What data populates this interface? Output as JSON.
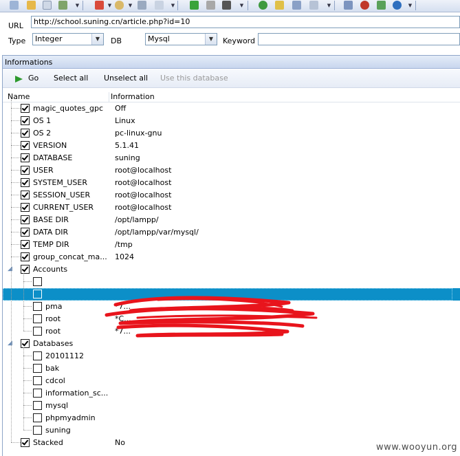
{
  "toolbar": {
    "icons": [
      "search-icon",
      "open-icon",
      "save-icon",
      "copy-icon",
      "paint-icon",
      "flag-icon",
      "palette-icon",
      "tool-icon",
      "doc-icon",
      "play-icon",
      "pause-icon",
      "stop-icon",
      "help-icon",
      "key-icon",
      "user-icon",
      "search-tool-icon",
      "home-icon",
      "bug-icon",
      "refresh-icon",
      "info-icon"
    ]
  },
  "url_row": {
    "label": "URL",
    "value": "http://school.suning.cn/article.php?id=10"
  },
  "type_row": {
    "type_label": "Type",
    "type_value": "Integer",
    "db_label": "DB",
    "db_value": "Mysql",
    "keyword_label": "Keyword",
    "keyword_value": ""
  },
  "panel": {
    "title": "Informations",
    "actions": {
      "go": "Go",
      "select_all": "Select all",
      "unselect_all": "Unselect all",
      "use_db": "Use this database"
    },
    "columns": {
      "name": "Name",
      "information": "Information"
    }
  },
  "info_rows": [
    {
      "name": "magic_quotes_gpc",
      "value": "Off"
    },
    {
      "name": "OS 1",
      "value": "Linux"
    },
    {
      "name": "OS 2",
      "value": "pc-linux-gnu"
    },
    {
      "name": "VERSION",
      "value": "5.1.41"
    },
    {
      "name": "DATABASE",
      "value": "suning"
    },
    {
      "name": "USER",
      "value": "root@localhost"
    },
    {
      "name": "SYSTEM_USER",
      "value": "root@localhost"
    },
    {
      "name": "SESSION_USER",
      "value": "root@localhost"
    },
    {
      "name": "CURRENT_USER",
      "value": "root@localhost"
    },
    {
      "name": "BASE DIR",
      "value": "/opt/lampp/"
    },
    {
      "name": "DATA DIR",
      "value": "/opt/lampp/var/mysql/"
    },
    {
      "name": "TEMP DIR",
      "value": "/tmp"
    },
    {
      "name": "group_concat_ma...",
      "value": "1024"
    }
  ],
  "accounts": {
    "label": "Accounts",
    "items": [
      {
        "name": "",
        "value": ""
      },
      {
        "name": "",
        "value": ""
      },
      {
        "name": "pma",
        "value": "*7..."
      },
      {
        "name": "root",
        "value": "*C..."
      },
      {
        "name": "root",
        "value": "*7..."
      }
    ]
  },
  "databases": {
    "label": "Databases",
    "items": [
      "20101112",
      "bak",
      "cdcol",
      "information_sc...",
      "mysql",
      "phpmyadmin",
      "suning"
    ]
  },
  "stacked": {
    "name": "Stacked",
    "value": "No"
  },
  "watermark": "www.wooyun.org",
  "colors": {
    "selection": "#0c8fc8",
    "go_icon": "#2e9a2e",
    "scribble": "#e8141c"
  }
}
